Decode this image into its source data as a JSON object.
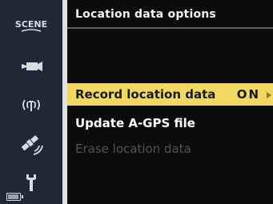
{
  "sidebar": {
    "items": [
      {
        "icon": "scene-mode-icon",
        "label": "SCENE"
      },
      {
        "icon": "movie-camera-icon"
      },
      {
        "icon": "network-icon"
      },
      {
        "icon": "satellite-icon"
      },
      {
        "icon": "wrench-icon"
      }
    ],
    "battery_icon": "battery-icon"
  },
  "screen": {
    "title": "Location data options"
  },
  "menu": {
    "items": [
      {
        "label": "Record location data",
        "value": "ON",
        "state": "selected"
      },
      {
        "label": "Update A-GPS file",
        "state": "enabled"
      },
      {
        "label": "Erase location data",
        "state": "disabled"
      }
    ]
  },
  "colors": {
    "highlight": "#f0d862",
    "sidebar": "#222833",
    "background": "#0c0c0d",
    "disabled_text": "#4e5257"
  }
}
